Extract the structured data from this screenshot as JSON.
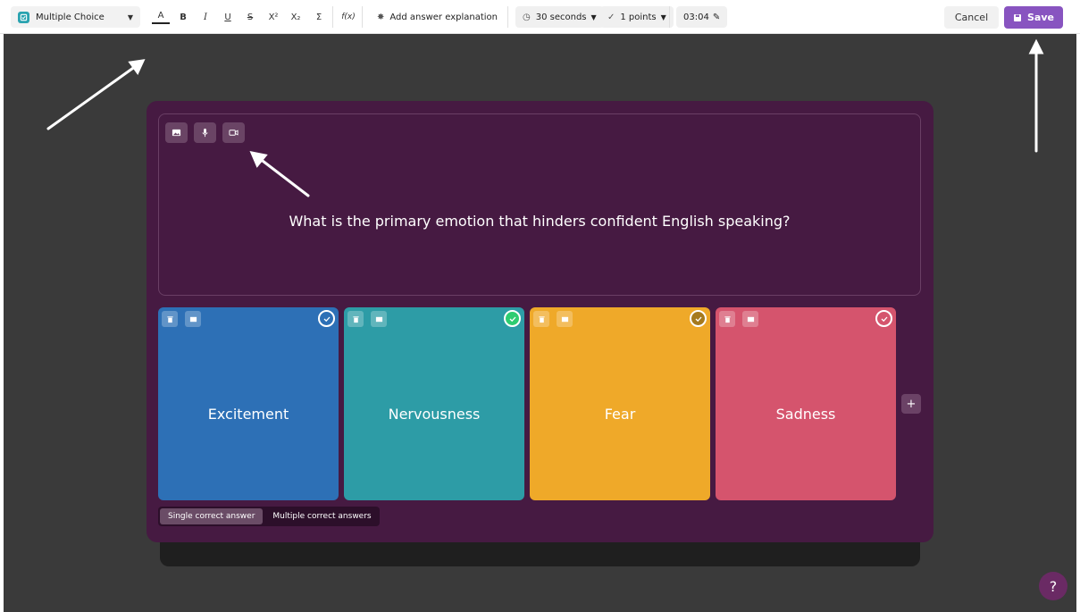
{
  "toolbar": {
    "question_type": "Multiple Choice",
    "format": {
      "text_color": "A",
      "bold": "B",
      "italic": "I",
      "underline": "U",
      "strikethrough": "S",
      "superscript": "X²",
      "subscript": "X₂",
      "sum": "Σ",
      "formula": "f(x)"
    },
    "explanation_label": "Add answer explanation",
    "time_label": "30 seconds",
    "points_label": "1 points",
    "timer_value": "03:04",
    "cancel_label": "Cancel",
    "save_label": "Save"
  },
  "question": {
    "text": "What is the primary emotion that hinders confident English speaking?"
  },
  "options": [
    {
      "label": "Excitement",
      "color": "#2d70b6",
      "correct": false
    },
    {
      "label": "Nervousness",
      "color": "#2d9ca6",
      "correct": true
    },
    {
      "label": "Fear",
      "color": "#efa929",
      "correct": false
    },
    {
      "label": "Sadness",
      "color": "#d5546d",
      "correct": false
    }
  ],
  "answer_mode": {
    "single": "Single correct answer",
    "multiple": "Multiple correct answers"
  },
  "add_option_label": "+",
  "help_label": "?",
  "colors": {
    "accent": "#8854c0",
    "editor_bg": "#461a42",
    "canvas_bg": "#3a3a3a"
  }
}
